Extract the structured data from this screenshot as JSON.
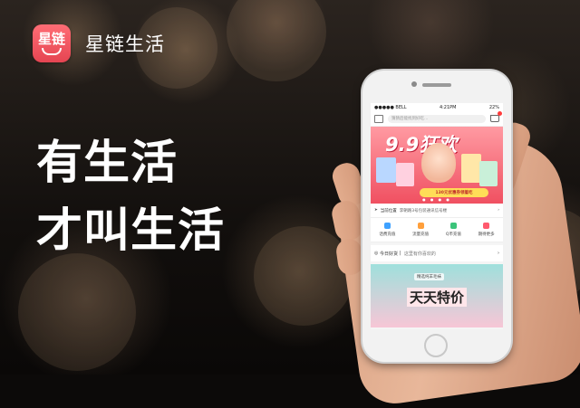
{
  "brand": {
    "logo_text": "星链",
    "name": "星链生活"
  },
  "slogan": {
    "line1": "有生活",
    "line2": "才叫生活"
  },
  "phone": {
    "status": {
      "carrier": "●●●●● BELL",
      "time": "4:21PM",
      "battery": "22%"
    },
    "search": {
      "placeholder": "猜猜后能找到好吃…"
    },
    "banner": {
      "title": "9.9狂欢",
      "coupon": "130元优惠券领着吃",
      "dots": "● ● ● ●"
    },
    "location": {
      "label": "当前位置",
      "address": "李朝路3号包装通讯信号楼"
    },
    "quicknav": [
      {
        "label": "话费充值",
        "color": "#3ea1ff"
      },
      {
        "label": "流量充值",
        "color": "#ff9f3b"
      },
      {
        "label": "Q币充值",
        "color": "#3bc47a"
      },
      {
        "label": "期待更多",
        "color": "#ff5a6e"
      }
    ],
    "recommend": {
      "title": "今日好货",
      "subtitle": "这里有你喜欢的",
      "arrow": "›"
    },
    "bottom_banner": {
      "top_text": "精选纯羊毛袜",
      "title": "天天特价"
    }
  }
}
